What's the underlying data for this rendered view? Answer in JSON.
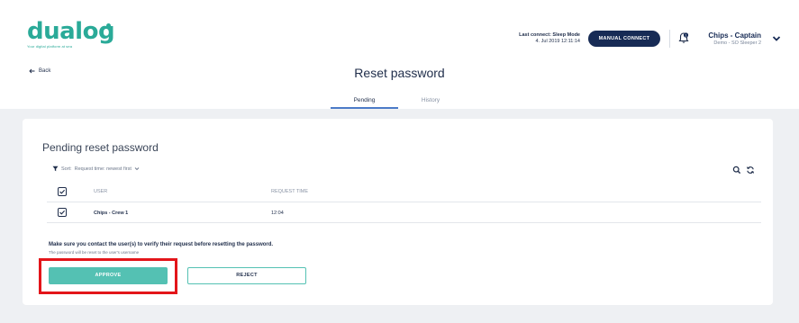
{
  "header": {
    "logo_word": "dualog",
    "logo_tagline": "Your digital platform at sea",
    "last_connect_label": "Last connect: Sleep Mode",
    "last_connect_time": "4. Jul 2019 12:11:14",
    "manual_connect_label": "MANUAL CONNECT",
    "user_name": "Chips - Captain",
    "user_sub": "Demo - SO Sleeper 2",
    "brand_color": "#2aaa98"
  },
  "nav": {
    "back_label": "Back"
  },
  "page": {
    "title": "Reset password",
    "tabs": [
      {
        "label": "Pending",
        "active": true
      },
      {
        "label": "History",
        "active": false
      }
    ]
  },
  "card": {
    "title": "Pending reset password",
    "sort_label": "Sort:",
    "sort_value": "Request time: newest first",
    "columns": [
      "USER",
      "REQUEST TIME"
    ],
    "rows": [
      {
        "user": "Chips - Crew 1",
        "request_time": "12:04",
        "checked": true
      }
    ],
    "warning": "Make sure you contact the user(s) to verify their request before resetting the password.",
    "warning_sub": "The password will be reset to the user's username",
    "approve_label": "APPROVE",
    "reject_label": "REJECT",
    "accent_color": "#54c1b3"
  }
}
